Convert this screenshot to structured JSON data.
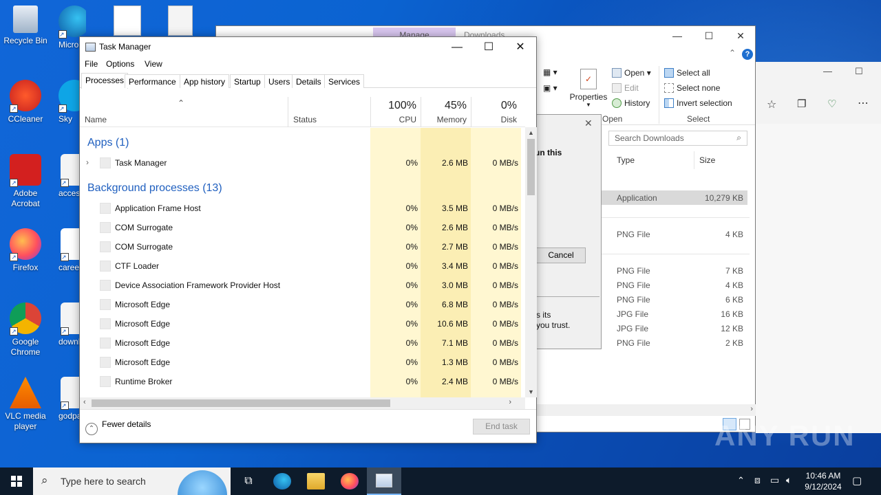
{
  "desktop_icons": [
    {
      "label": "Recycle Bin"
    },
    {
      "label": "Micro Edg"
    },
    {
      "label": "CCleaner"
    },
    {
      "label": "Sky"
    },
    {
      "label": "Adobe Acrobat"
    },
    {
      "label": "access"
    },
    {
      "label": "Firefox"
    },
    {
      "label": "careers"
    },
    {
      "label": "Google Chrome"
    },
    {
      "label": "downlo"
    },
    {
      "label": "VLC media player"
    },
    {
      "label": "godpay"
    }
  ],
  "explorer": {
    "tab_active": "Manage",
    "tab_other": "Downloads",
    "ribbon": {
      "properties": "Properties",
      "open": "Open",
      "edit": "Edit",
      "history": "History",
      "group_open": "Open",
      "select_all": "Select all",
      "select_none": "Select none",
      "invert_selection": "Invert selection",
      "group_select": "Select"
    },
    "search_placeholder": "Search Downloads",
    "columns": {
      "type": "Type",
      "size": "Size"
    },
    "files": [
      {
        "type": "Application",
        "size": "10,279 KB",
        "selected": true
      },
      {
        "type": "PNG File",
        "size": "4 KB"
      },
      {
        "type": "PNG File",
        "size": "7 KB"
      },
      {
        "type": "PNG File",
        "size": "4 KB"
      },
      {
        "type": "PNG File",
        "size": "6 KB"
      },
      {
        "type": "JPG File",
        "size": "16 KB"
      },
      {
        "type": "JPG File",
        "size": "12 KB"
      },
      {
        "type": "PNG File",
        "size": "2 KB"
      }
    ]
  },
  "dialog": {
    "line1": "un this",
    "cancel": "Cancel",
    "line2": "s its",
    "line3": "you trust."
  },
  "task_manager": {
    "title": "Task Manager",
    "menu": {
      "file": "File",
      "options": "Options",
      "view": "View"
    },
    "tabs": [
      "Processes",
      "Performance",
      "App history",
      "Startup",
      "Users",
      "Details",
      "Services"
    ],
    "columns": {
      "name": "Name",
      "status": "Status",
      "cpu_pct": "100%",
      "cpu": "CPU",
      "mem_pct": "45%",
      "mem": "Memory",
      "disk_pct": "0%",
      "disk": "Disk"
    },
    "apps_group": "Apps (1)",
    "apps": [
      {
        "name": "Task Manager",
        "cpu": "0%",
        "mem": "2.6 MB",
        "disk": "0 MB/s"
      }
    ],
    "bg_group": "Background processes (13)",
    "background": [
      {
        "name": "Application Frame Host",
        "cpu": "0%",
        "mem": "3.5 MB",
        "disk": "0 MB/s"
      },
      {
        "name": "COM Surrogate",
        "cpu": "0%",
        "mem": "2.6 MB",
        "disk": "0 MB/s"
      },
      {
        "name": "COM Surrogate",
        "cpu": "0%",
        "mem": "2.7 MB",
        "disk": "0 MB/s"
      },
      {
        "name": "CTF Loader",
        "cpu": "0%",
        "mem": "3.4 MB",
        "disk": "0 MB/s"
      },
      {
        "name": "Device Association Framework Provider Host",
        "cpu": "0%",
        "mem": "3.0 MB",
        "disk": "0 MB/s"
      },
      {
        "name": "Microsoft Edge",
        "cpu": "0%",
        "mem": "6.8 MB",
        "disk": "0 MB/s"
      },
      {
        "name": "Microsoft Edge",
        "cpu": "0%",
        "mem": "10.6 MB",
        "disk": "0 MB/s"
      },
      {
        "name": "Microsoft Edge",
        "cpu": "0%",
        "mem": "7.1 MB",
        "disk": "0 MB/s"
      },
      {
        "name": "Microsoft Edge",
        "cpu": "0%",
        "mem": "1.3 MB",
        "disk": "0 MB/s"
      },
      {
        "name": "Runtime Broker",
        "cpu": "0%",
        "mem": "2.4 MB",
        "disk": "0 MB/s"
      }
    ],
    "fewer_details": "Fewer details",
    "end_task": "End task"
  },
  "taskbar": {
    "search_placeholder": "Type here to search",
    "time": "10:46 AM",
    "date": "9/12/2024"
  },
  "watermark": "ANY RUN",
  "colors": {
    "desktop": "#0b63d1",
    "taskbar": "#0d1b2b",
    "cpu_col": "#fff7d1",
    "mem_col": "#fbeeb4",
    "group_text": "#1f5fbf"
  }
}
